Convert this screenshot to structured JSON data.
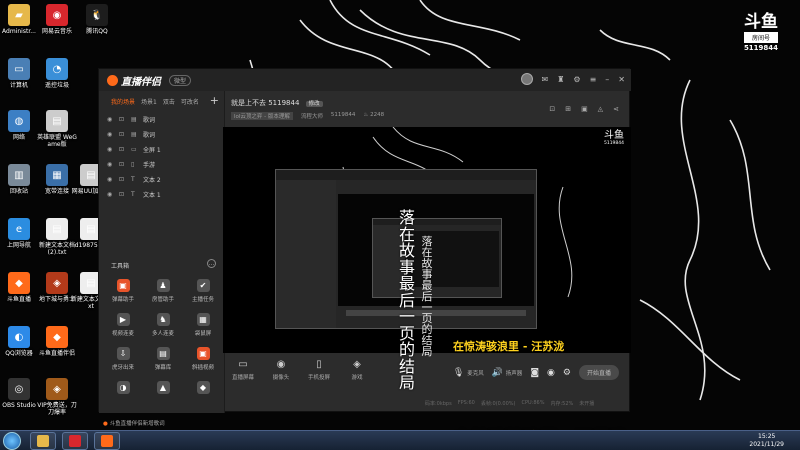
{
  "desktop": {
    "icons": [
      {
        "label": "Administr...",
        "color": "#e6b84a",
        "glyph": "▰"
      },
      {
        "label": "网易云音乐",
        "color": "#d8272d",
        "glyph": "◉"
      },
      {
        "label": "腾讯QQ",
        "color": "#1d1d1d",
        "glyph": "🐧"
      },
      {
        "label": "计算机",
        "color": "#4a7fb5",
        "glyph": "▭"
      },
      {
        "label": "遥控垃圾",
        "color": "#3a8fd8",
        "glyph": "◔"
      },
      {
        "label": "网络",
        "color": "#3c7fc4",
        "glyph": "◍"
      },
      {
        "label": "英雄联盟\nWeGame版",
        "color": "#cccccc",
        "glyph": "▤"
      },
      {
        "label": "回收站",
        "color": "#7a8a99",
        "glyph": "▥"
      },
      {
        "label": "宽带连接",
        "color": "#3a6fa8",
        "glyph": "▦"
      },
      {
        "label": "网易UU加速器",
        "color": "#cccccc",
        "glyph": "▤"
      },
      {
        "label": "上网导航",
        "color": "#2b8de0",
        "glyph": "e"
      },
      {
        "label": "新建文本文档 (2).txt",
        "color": "#eeeeee",
        "glyph": "▤"
      },
      {
        "label": "d198757...",
        "color": "#eeeeee",
        "glyph": "▤"
      },
      {
        "label": "斗鱼直播",
        "color": "#ff6a1a",
        "glyph": "◆"
      },
      {
        "label": "地下城与勇士",
        "color": "#b33a1a",
        "glyph": "◈"
      },
      {
        "label": "新建文本文档.txt",
        "color": "#eeeeee",
        "glyph": "▤"
      },
      {
        "label": "QQ浏览器",
        "color": "#2d8ae8",
        "glyph": "◐"
      },
      {
        "label": "斗鱼直播伴侣",
        "color": "#ff6a1a",
        "glyph": "◆"
      },
      {
        "label": "OBS Studio",
        "color": "#333333",
        "glyph": "◎"
      },
      {
        "label": "VIP免费送，刀刀爆率",
        "color": "#a05a1a",
        "glyph": "◈"
      }
    ]
  },
  "room_badge": {
    "logo": "斗鱼",
    "tag": "房间号",
    "number": "5119844"
  },
  "app": {
    "title": "直播伴侣",
    "version_badge": "微型",
    "scene_tabs": [
      "我的场景",
      "场景1",
      "双击",
      "可改名"
    ],
    "sources": [
      "歌词",
      "歌词",
      "全屏 1",
      "手游",
      "文本 2",
      "文本 1"
    ],
    "tools_title": "工具箱",
    "tools": [
      {
        "label": "弹幕助手",
        "color": "#e8542a",
        "glyph": "▣"
      },
      {
        "label": "房管助手",
        "color": "#555555",
        "glyph": "♟"
      },
      {
        "label": "主播任务",
        "color": "#555555",
        "glyph": "✔"
      },
      {
        "label": "视频连麦",
        "color": "#555555",
        "glyph": "▶"
      },
      {
        "label": "多人连麦",
        "color": "#555555",
        "glyph": "♞"
      },
      {
        "label": "袋鼠屏",
        "color": "#555555",
        "glyph": "▦"
      },
      {
        "label": "虎牙出来",
        "color": "#555555",
        "glyph": "⇩"
      },
      {
        "label": "弹幕库",
        "color": "#555555",
        "glyph": "▤"
      },
      {
        "label": "斜插视频",
        "color": "#e8542a",
        "glyph": "▣"
      },
      {
        "label": "",
        "color": "#555555",
        "glyph": "◑"
      },
      {
        "label": "",
        "color": "#555555",
        "glyph": "▲"
      },
      {
        "label": "",
        "color": "#555555",
        "glyph": "◆"
      }
    ],
    "bottom_tip": "斗鱼直播伴侣新增歌词",
    "room": {
      "title": "就是上不去 5119844",
      "edit": "修改",
      "category": "lol云顶之弈 - 版本理解",
      "host": "流程大师",
      "room_id": "5119844",
      "heat": "2248"
    },
    "toolbar": [
      {
        "label": "直播屏幕",
        "glyph": "▭"
      },
      {
        "label": "摄像头",
        "glyph": "◉"
      },
      {
        "label": "手机投屏",
        "glyph": "▯"
      },
      {
        "label": "游戏",
        "glyph": "◈"
      }
    ],
    "mic_label": "麦克风",
    "speaker_label": "扬声器",
    "live_button": "开始直播",
    "stats": [
      "码率:0kbps",
      "FPS:60",
      "丢帧:0(0.00%)",
      "CPU:86%",
      "内存:52%",
      "未开播"
    ]
  },
  "preview": {
    "logo": "斗鱼",
    "logo_num": "5119844",
    "lyric_vertical": "落在故事最后一页的结局",
    "lyric_horizontal": "在惊涛骇浪里 - 汪苏泷"
  },
  "taskbar": {
    "time": "15:25",
    "date": "2021/11/29"
  }
}
